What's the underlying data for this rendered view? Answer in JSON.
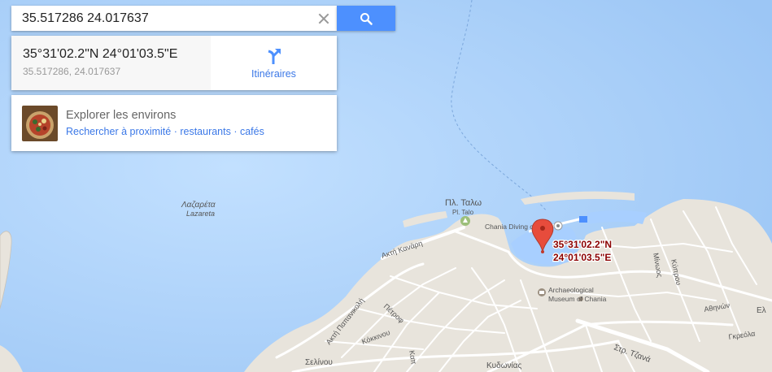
{
  "search": {
    "query": "35.517286 24.017637"
  },
  "place": {
    "title": "35°31'02.2\"N 24°01'03.5\"E",
    "decimal": "35.517286, 24.017637",
    "directions_label": "Itinéraires"
  },
  "explore": {
    "title": "Explorer les environs",
    "links": [
      "Rechercher à proximité",
      "restaurants",
      "cafés"
    ],
    "separator": " · "
  },
  "map_labels": {
    "lazareta_gr": "Λαζαρέτα",
    "lazareta_en": "Lazareta",
    "talo_gr": "Πλ. Ταλω",
    "talo_en": "Pl. Talo",
    "chania_diving": "Chania Diving c",
    "museum_1": "Archaeological",
    "museum_2": "Museum of Chania",
    "akti_kanari": "Ακτή Κανάρη",
    "akti_papanikoli": "Ακτή Παπανικολή",
    "petrof": "Πέτροφ",
    "kokkinou": "Κόκκινου",
    "kapi": "Καπ",
    "selinou": "Σελίνου",
    "kydonias": "Κυδωνίας",
    "minoos": "Μίνωος",
    "kyprou": "Κύπρου",
    "athinon": "Αθηνών",
    "elas": "Ελ",
    "gkreola": "Γκρεόλα",
    "tzanaki": "Στρ. Τζανά",
    "pin_line1": "35°31'02.2\"N",
    "pin_line2": "24°01'03.5\"E"
  },
  "colors": {
    "sea": "#a3ccff",
    "land": "#e8e4dc",
    "accent_blue": "#4d90fe",
    "link_blue": "#3b78e7",
    "pin_red": "#e74c3c",
    "pin_label": "#8b0000"
  },
  "icons": {
    "clear": "close-icon",
    "search": "search-icon",
    "directions": "directions-icon",
    "pin": "location-pin-icon"
  }
}
